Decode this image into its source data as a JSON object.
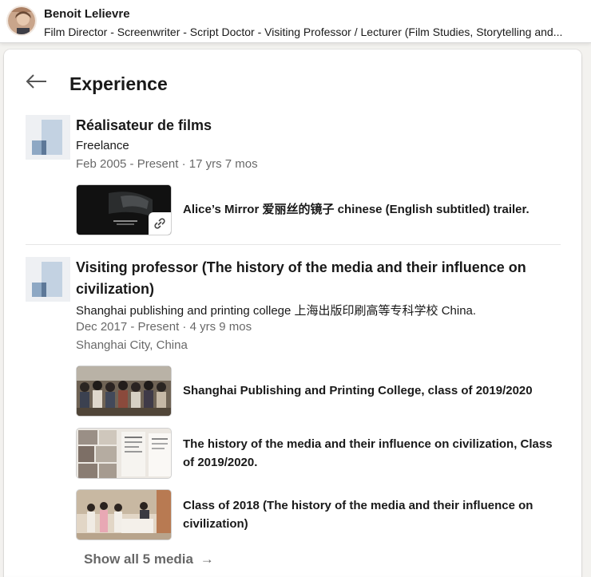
{
  "topbar": {
    "name": "Benoit Lelievre",
    "headline": "Film Director - Screenwriter - Script Doctor - Visiting Professor / Lecturer (Film Studies, Storytelling and..."
  },
  "section": {
    "title": "Experience"
  },
  "positions": [
    {
      "title": "Réalisateur de films",
      "company": "Freelance",
      "dates": "Feb 2005 - Present · 17 yrs 7 mos",
      "location": "",
      "media": [
        {
          "title": "Alice’s Mirror 爱丽丝的镜子 chinese (English subtitled) trailer.",
          "thumb_icon": "link-icon"
        }
      ]
    },
    {
      "title": "Visiting professor (The history of the media and their influence on civilization)",
      "company": "Shanghai publishing and printing college 上海出版印刷高等专科学校 China.",
      "dates": "Dec 2017 - Present · 4 yrs 9 mos",
      "location": "Shanghai City, China",
      "media": [
        {
          "title": "Shanghai Publishing and Printing College, class of 2019/2020"
        },
        {
          "title": "The history of the media and their influence on civilization, Class of 2019/2020."
        },
        {
          "title": "Class of 2018 (The history of the media and their influence on civilization)"
        }
      ]
    }
  ],
  "show_all": {
    "label": "Show all 5 media",
    "icon": "arrow-right-icon"
  },
  "colors": {
    "logo_light": "#c3d2e2",
    "logo_mid": "#8ea8c4",
    "logo_dark": "#5d7898",
    "text_secondary": "#666666"
  }
}
